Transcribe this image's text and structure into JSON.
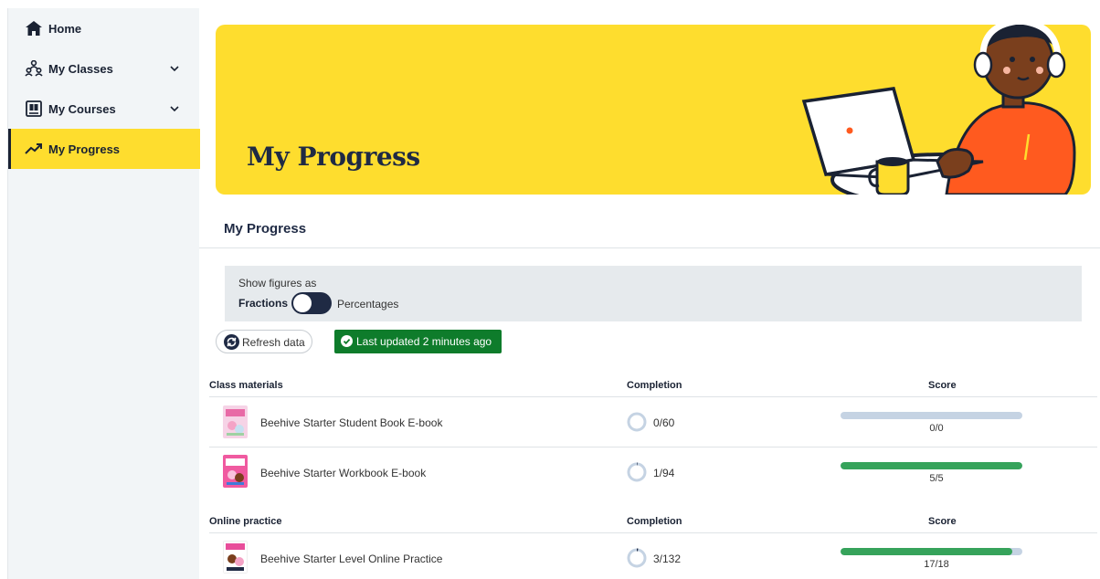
{
  "sidebar": {
    "items": [
      {
        "label": "Home",
        "icon": "home-icon"
      },
      {
        "label": "My Classes",
        "icon": "classes-icon",
        "expandable": true
      },
      {
        "label": "My Courses",
        "icon": "courses-icon",
        "expandable": true
      },
      {
        "label": "My Progress",
        "icon": "trending-up-icon",
        "active": true
      }
    ]
  },
  "hero": {
    "title": "My Progress",
    "background": "#fedd2e"
  },
  "section": {
    "title": "My Progress"
  },
  "display_toggle": {
    "caption": "Show figures as",
    "left_label": "Fractions",
    "right_label": "Percentages",
    "selected": "Fractions"
  },
  "actions": {
    "refresh_label": "Refresh data",
    "updated_label": "Last updated 2 minutes ago"
  },
  "tables": {
    "class_materials": {
      "header": {
        "name": "Class materials",
        "completion": "Completion",
        "score": "Score"
      },
      "rows": [
        {
          "name": "Beehive Starter Student Book E-book",
          "completion": "0/60",
          "completion_fraction": 0.0,
          "score": "0/0",
          "score_fraction": 0.0
        },
        {
          "name": "Beehive Starter Workbook E-book",
          "completion": "1/94",
          "completion_fraction": 0.011,
          "score": "5/5",
          "score_fraction": 1.0
        }
      ]
    },
    "online_practice": {
      "header": {
        "name": "Online practice",
        "completion": "Completion",
        "score": "Score"
      },
      "rows": [
        {
          "name": "Beehive Starter Level Online Practice",
          "completion": "3/132",
          "completion_fraction": 0.023,
          "score": "17/18",
          "score_fraction": 0.944
        }
      ]
    }
  },
  "colors": {
    "accent_yellow": "#fedd2e",
    "navy": "#1f2a44",
    "success_green": "#0e7c2b",
    "bar_green": "#36a35b",
    "bar_track": "#c5d3e3"
  }
}
